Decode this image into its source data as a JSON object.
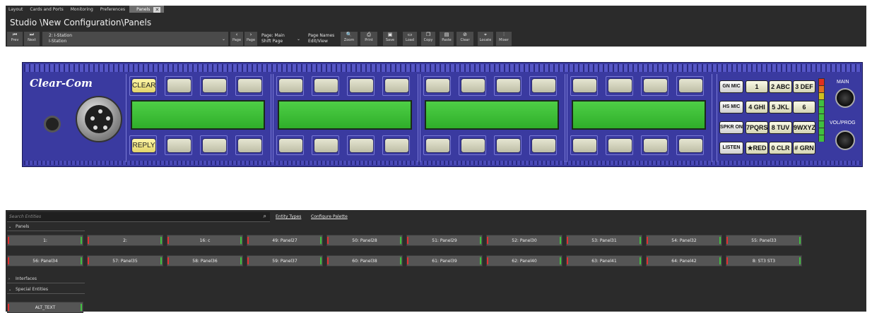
{
  "tabs": [
    {
      "label": "Layout",
      "active": false
    },
    {
      "label": "Cards and Ports",
      "active": false
    },
    {
      "label": "Monitoring",
      "active": false
    },
    {
      "label": "Preferences",
      "active": false
    },
    {
      "label": "Panels",
      "active": true
    }
  ],
  "window_title": "Studio \\New Configuration\\Panels",
  "toolbar": {
    "prev": {
      "icon": "prev-icon",
      "label": "Prev"
    },
    "next": {
      "icon": "next-icon",
      "label": "Next"
    },
    "station_line1": "2: I-Station",
    "station_line2": "I-Station",
    "page_prev": {
      "icon": "chevron-left-icon",
      "label": "Page"
    },
    "page_next": {
      "icon": "chevron-right-icon",
      "label": "Page"
    },
    "page_main_line1": "Page: Main",
    "page_main_line2": "Shift Page",
    "page_names_line1": "Page Names",
    "page_names_line2": "Edit/View",
    "zoom": {
      "icon": "zoom-icon",
      "label": "Zoom"
    },
    "print": {
      "icon": "print-icon",
      "label": "Print"
    },
    "save": {
      "icon": "save-icon",
      "label": "Save"
    },
    "load": {
      "icon": "load-icon",
      "label": "Load"
    },
    "copy": {
      "icon": "copy-icon",
      "label": "Copy"
    },
    "paste": {
      "icon": "paste-icon",
      "label": "Paste"
    },
    "clear": {
      "icon": "clear-icon",
      "label": "Clear"
    },
    "locate": {
      "icon": "locate-icon",
      "label": "Locate"
    },
    "mixer": {
      "icon": "mixer-icon",
      "label": "Mixer"
    }
  },
  "panel": {
    "logo": "Clear-Com",
    "left_keys": {
      "top": "CLEAR",
      "bottom": "REPLY"
    },
    "keypad": [
      [
        "GN MIC",
        "1",
        "2 ABC",
        "3 DEF"
      ],
      [
        "HS MIC",
        "4 GHI",
        "5 JKL",
        "6"
      ],
      [
        "SPKR ON",
        "7PQRS",
        "8 TUV",
        "9WXYZ"
      ],
      [
        "LISTEN",
        "★RED",
        "0 CLR",
        "# GRN"
      ]
    ],
    "knob_main_label": "MAIN",
    "knob_vol_label": "VOL/PROG",
    "vu_colors": [
      "#e03020",
      "#e07020",
      "#d0c020",
      "#40c040",
      "#40c040",
      "#40c040",
      "#40c040",
      "#40c040",
      "#40c040"
    ]
  },
  "bottom": {
    "search_placeholder": "Search Entities",
    "entity_types": "Entity Types",
    "configure_palette": "Configure Palette",
    "sections": {
      "panels": "Panels",
      "interfaces": "Interfaces",
      "special": "Special Entities"
    },
    "panel_tiles_row1": [
      "1:",
      "2:",
      "16: c",
      "49: Panel27",
      "50: Panel28",
      "51: Panel29",
      "52: Panel30",
      "53: Panel31",
      "54: Panel32",
      "55: Panel33"
    ],
    "panel_tiles_row2": [
      "56: Panel34",
      "57: Panel35",
      "58: Panel36",
      "59: Panel37",
      "60: Panel38",
      "61: Panel39",
      "62: Panel40",
      "63: Panel41",
      "64: Panel42",
      "8: ST3  ST3"
    ],
    "special_tiles": [
      "ALT_TEXT"
    ]
  }
}
